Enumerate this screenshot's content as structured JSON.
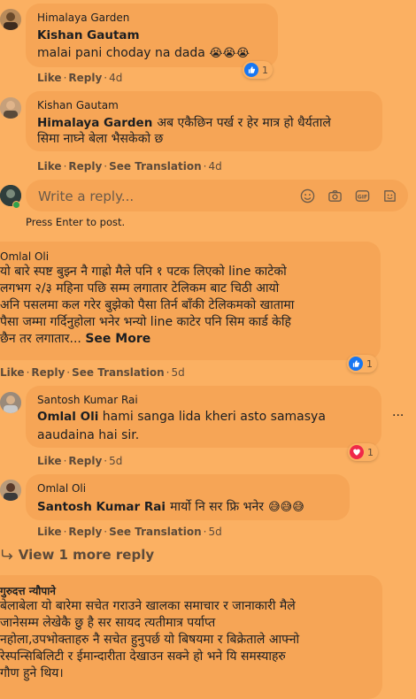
{
  "comments": [
    {
      "author_small": "Himalaya Garden",
      "author": "Kishan Gautam",
      "text": "malai pani choday na dada",
      "emoji": "😭😭😭",
      "like": "Like",
      "reply": "Reply",
      "time": "4d",
      "reaction_count": "1"
    },
    {
      "author_small": "Kishan Gautam",
      "author": "Himalaya Garden",
      "text_line1": "अब एकैछिन पर्ख र हेर मात्र हो धैर्यताले",
      "text_line2": "सिमा नाघ्ने बेला भैसकेको छ",
      "like": "Like",
      "reply": "Reply",
      "see_translation": "See Translation",
      "time": "4d"
    },
    {
      "author_small": "Omlal Oli",
      "lines": [
        "यो बारे स्पष्ट बुझ्न नै गाह्रो मैले पनि १ पटक लिएको line काटेको",
        "लगभग २/३ महिना पछि सम्म लगातार टेलिकम बाट चिठी आयो",
        "अनि पसलमा कल गरेर बुझेको पैसा तिर्न बाँकी टेलिकमको खातामा",
        "पैसा जम्मा गर्दिनुहोला भनेर भन्यो line काटेर पनि सिम कार्ड केहि"
      ],
      "last_line": "छैन तर लगातार...",
      "see_more": "See More",
      "like": "Like",
      "reply": "Reply",
      "see_translation": "See Translation",
      "time": "5d",
      "reaction_count": "1"
    },
    {
      "author_small": "Santosh Kumar Rai",
      "author": "Omlal Oli",
      "text_line1": "hami sanga lida kheri asto samasya",
      "text_line2": "aaudaina hai sir.",
      "like": "Like",
      "reply": "Reply",
      "time": "5d",
      "reaction_count": "1",
      "menu": "···"
    },
    {
      "author_small": "Omlal Oli",
      "author": "Santosh Kumar Rai",
      "text": "मार्यो नि सर फ्रि भनेर",
      "emoji": "😅😅😅",
      "like": "Like",
      "reply": "Reply",
      "see_translation": "See Translation",
      "time": "5d"
    },
    {
      "author_small": "गुरुदत्त न्यौपाने",
      "lines": [
        "बेलाबेला यो बारेमा सचेत गराउने खालका समाचार र जानाकारी मैले",
        "जानेसम्म लेखेकै छु है सर सायद त्यतीमात्र पर्याप्त",
        "नहोला,उपभोक्ताहरु नै सचेत हुनुपर्छ यो बिषयमा र बिक्रेताले आफ्नो",
        "रेस्पन्सिबिलिटी र ईमान्दारीता देखाउन सक्ने हो भने यि समस्याहरु",
        "गौण हुने थिय।"
      ]
    }
  ],
  "reply_box": {
    "placeholder": "Write a reply...",
    "hint": "Press Enter to post."
  },
  "view_more": "View 1 more reply",
  "colors": {
    "background": "#fbb062",
    "bubble": "#f6a556",
    "like_blue": "#1877f2",
    "love_red": "#f02849"
  }
}
